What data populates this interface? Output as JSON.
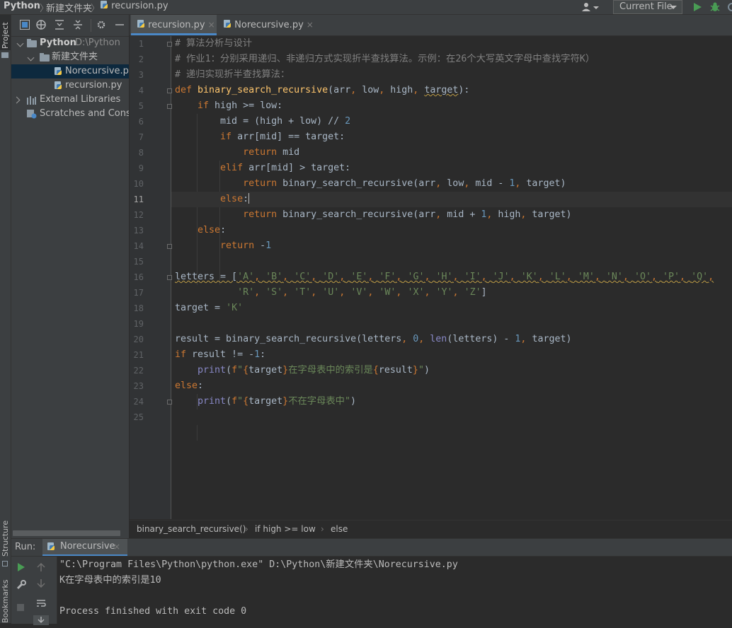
{
  "nav": {
    "project": "Python",
    "folder": "新建文件夹",
    "file": "recursion.py",
    "run_config": "Current File"
  },
  "side_tabs": {
    "project": "Project",
    "structure": "Structure",
    "bookmarks": "Bookmarks"
  },
  "project_tree": {
    "root_name": "Python",
    "root_path": "D:\\Python",
    "folder": "新建文件夹",
    "files": [
      "Norecursive.py",
      "recursion.py"
    ],
    "external": "External Libraries",
    "scratches": "Scratches and Consoles"
  },
  "tabs": [
    {
      "label": "recursion.py",
      "close": "×"
    },
    {
      "label": "Norecursive.py",
      "close": "×"
    }
  ],
  "editor": {
    "line_numbers": [
      "1",
      "2",
      "3",
      "4",
      "5",
      "6",
      "7",
      "8",
      "9",
      "10",
      "11",
      "12",
      "13",
      "14",
      "15",
      "16",
      "17",
      "18",
      "19",
      "20",
      "21",
      "22",
      "23",
      "24",
      "25"
    ],
    "current_line": 11
  },
  "code_text": [
    "# 算法分析与设计",
    "# 作业1：分别采用递归、非递归方式实现折半查找算法。示例：在26个大写英文字母中查找字符K）",
    "# 递归实现折半查找算法：",
    "def binary_search_recursive(arr, low, high, target):",
    "    if high >= low:",
    "        mid = (high + low) // 2",
    "        if arr[mid] == target:",
    "            return mid",
    "        elif arr[mid] > target:",
    "            return binary_search_recursive(arr, low, mid - 1, target)",
    "        else:",
    "            return binary_search_recursive(arr, mid + 1, high, target)",
    "    else:",
    "        return -1",
    "",
    "letters = ['A', 'B', 'C', 'D', 'E', 'F', 'G', 'H', 'I', 'J', 'K', 'L', 'M', 'N', 'O', 'P', 'Q',",
    "           'R', 'S', 'T', 'U', 'V', 'W', 'X', 'Y', 'Z']",
    "target = 'K'",
    "",
    "result = binary_search_recursive(letters, 0, len(letters) - 1, target)",
    "if result != -1:",
    "    print(f\"{target}在字母表中的索引是{result}\")",
    "else:",
    "    print(f\"{target}不在字母表中\")",
    ""
  ],
  "breadcrumb": [
    "binary_search_recursive()",
    "if high >= low",
    "else"
  ],
  "run": {
    "label": "Run:",
    "tab": "Norecursive",
    "close": "×",
    "output": [
      "\"C:\\Program Files\\Python\\python.exe\" D:\\Python\\新建文件夹\\Norecursive.py",
      "K在字母表中的索引是10",
      "",
      "Process finished with exit code 0"
    ]
  },
  "colors": {
    "keyword": "#cc7832",
    "function": "#ffc66d",
    "number": "#6897bb",
    "string": "#6a8759",
    "comment": "#808080",
    "builtin": "#8888c6",
    "selection": "#0d293e",
    "run_green": "#499c54"
  }
}
